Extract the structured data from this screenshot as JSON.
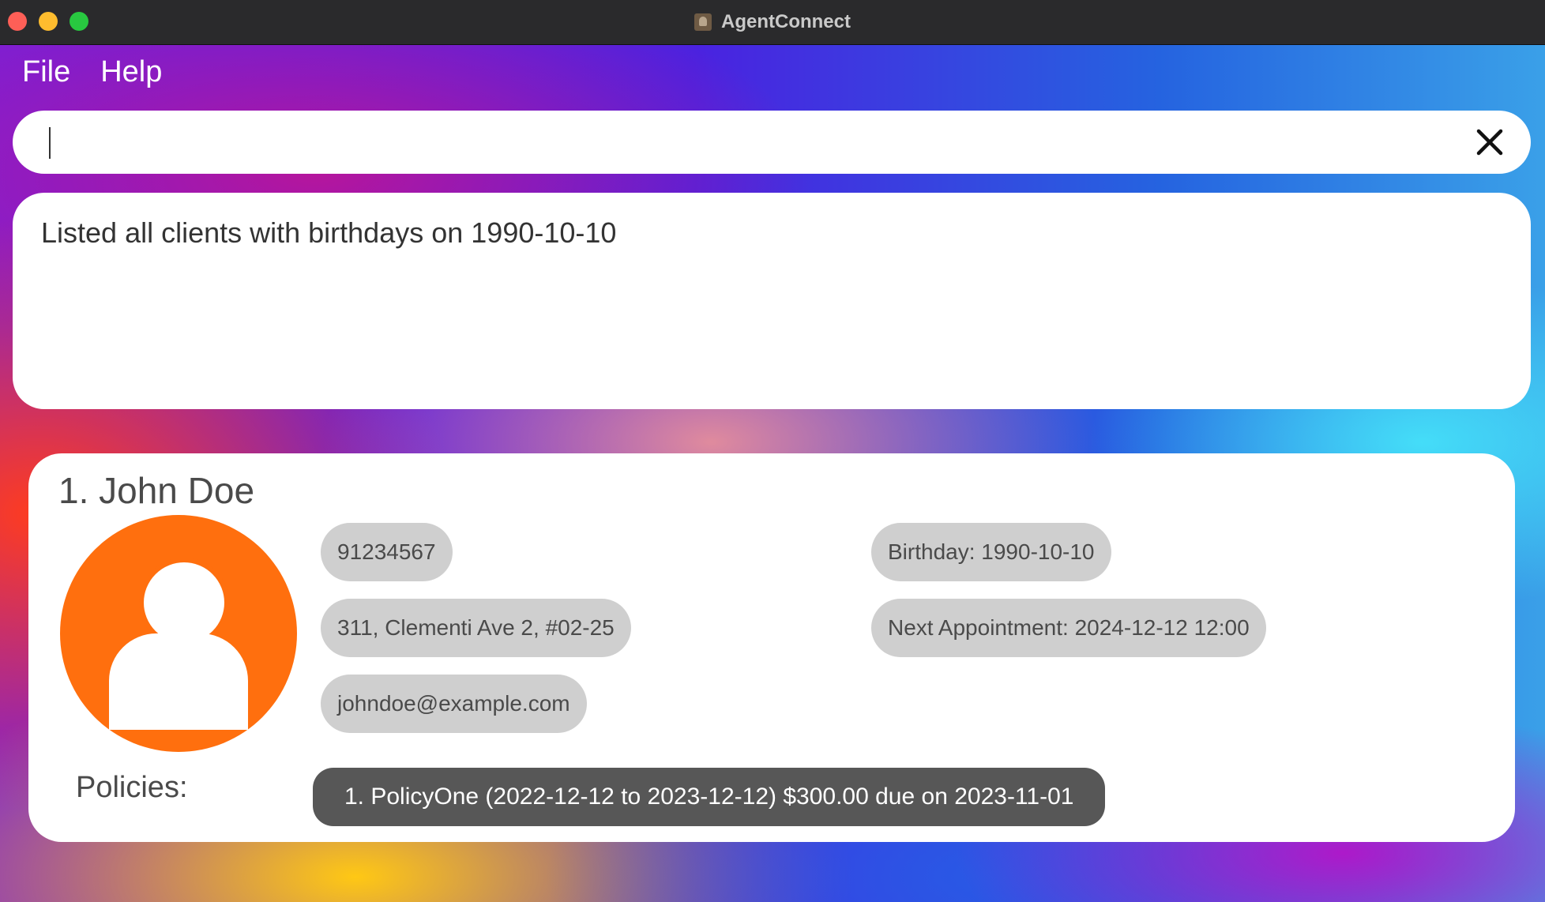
{
  "window": {
    "title": "AgentConnect",
    "colors": {
      "titlebar": "#2a2a2c",
      "close": "#fe5f57",
      "minimize": "#febc2e",
      "maximize": "#28c840"
    }
  },
  "menu": {
    "items": [
      {
        "label": "File"
      },
      {
        "label": "Help"
      }
    ]
  },
  "command": {
    "value": "",
    "placeholder": "",
    "clear_icon": "close-icon"
  },
  "result": {
    "message": "Listed all clients with birthdays on 1990-10-10"
  },
  "clients": [
    {
      "name": "1. John Doe",
      "avatar_icon": "person-icon",
      "avatar_color": "#ff6f0e",
      "phone": "91234567",
      "address": "311, Clementi Ave 2, #02-25",
      "email": "johndoe@example.com",
      "birthday": "Birthday: 1990-10-10",
      "next_appointment": "Next Appointment: 2024-12-12 12:00",
      "policies_label": "Policies:",
      "policies": [
        {
          "text": "1. PolicyOne (2022-12-12 to 2023-12-12) $300.00 due on 2023-11-01"
        }
      ]
    }
  ]
}
